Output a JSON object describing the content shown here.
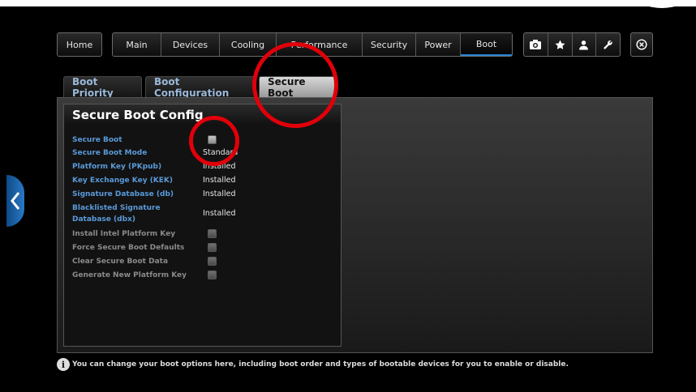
{
  "nav": {
    "home": "Home",
    "items": [
      "Main",
      "Devices",
      "Cooling",
      "Performance",
      "Security",
      "Power",
      "Boot"
    ],
    "icons": [
      "camera-icon",
      "star-icon",
      "user-icon",
      "wrench-icon"
    ],
    "close_icon": "close-circle-icon"
  },
  "tabs": [
    {
      "label": "Boot Priority"
    },
    {
      "label": "Boot Configuration"
    },
    {
      "label": "Secure Boot",
      "active": true
    }
  ],
  "panel": {
    "title": "Secure Boot Config",
    "rows": [
      {
        "label": "Secure Boot",
        "type": "checkbox"
      },
      {
        "label": "Secure Boot Mode",
        "value": "Standard"
      },
      {
        "label": "Platform Key (PKpub)",
        "value": "Installed"
      },
      {
        "label": "Key Exchange Key (KEK)",
        "value": "Installed"
      },
      {
        "label": "Signature Database (db)",
        "value": "Installed"
      },
      {
        "label": "Blacklisted Signature Database (dbx)",
        "value": "Installed"
      },
      {
        "label": "Install Intel Platform Key",
        "type": "checkbox",
        "disabled": true
      },
      {
        "label": "Force Secure Boot Defaults",
        "type": "checkbox",
        "disabled": true
      },
      {
        "label": "Clear Secure Boot Data",
        "type": "checkbox",
        "disabled": true
      },
      {
        "label": "Generate New Platform Key",
        "type": "checkbox",
        "disabled": true
      }
    ]
  },
  "info_text": "You can change your boot options here, including boot order and types of bootable devices for you to enable or disable.",
  "colors": {
    "accent": "#2a83d6",
    "label_blue": "#5a9ad8",
    "highlight_red": "#e0000a"
  }
}
